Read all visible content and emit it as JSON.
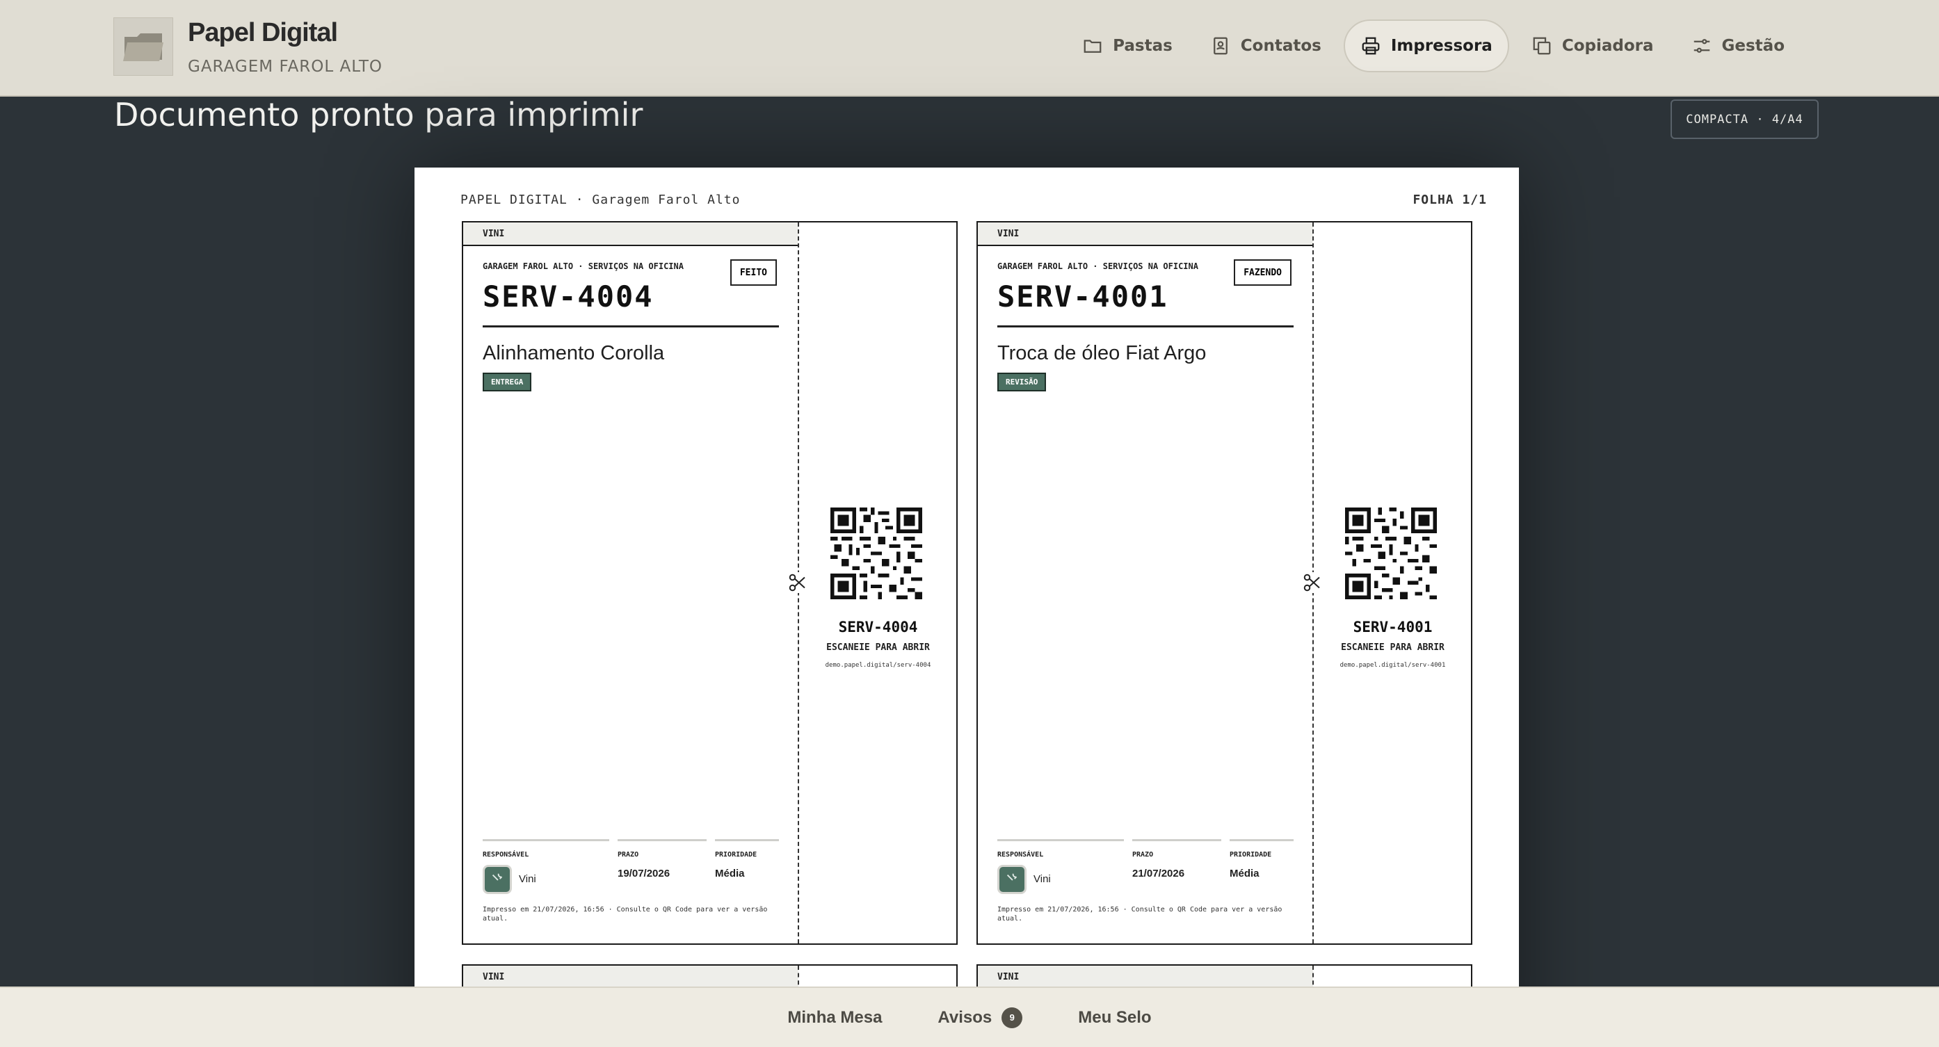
{
  "app": {
    "title": "Papel Digital",
    "subtitle": "GARAGEM FAROL ALTO",
    "logo_icon": "folder-icon"
  },
  "nav": [
    {
      "label": "Pastas",
      "icon": "folder-icon",
      "active": false
    },
    {
      "label": "Contatos",
      "icon": "contact-book-icon",
      "active": false
    },
    {
      "label": "Impressora",
      "icon": "printer-icon",
      "active": true
    },
    {
      "label": "Copiadora",
      "icon": "copy-icon",
      "active": false
    },
    {
      "label": "Gestão",
      "icon": "sliders-icon",
      "active": false
    }
  ],
  "main": {
    "page_title": "Documento pronto para imprimir",
    "mode_badge": "COMPACTA · 4/A4"
  },
  "sheet": {
    "header_left": "PAPEL DIGITAL · Garagem Farol Alto",
    "header_right": "FOLHA 1/1",
    "tickets": [
      {
        "owner_tab": "VINI",
        "company": "GARAGEM FAROL ALTO · SERVIÇOS NA OFICINA",
        "status": "FEITO",
        "code": "SERV-4004",
        "title": "Alinhamento Corolla",
        "tag": "ENTREGA",
        "qr_code": "SERV-4004",
        "qr_hint": "ESCANEIE PARA ABRIR",
        "qr_url": "demo.papel.digital/serv-4004",
        "responsavel_label": "RESPONSÁVEL",
        "responsavel": "Vini",
        "prazo_label": "PRAZO",
        "prazo": "19/07/2026",
        "prioridade_label": "PRIORIDADE",
        "prioridade": "Média",
        "footnote": "Impresso em 21/07/2026, 16:56 · Consulte o QR Code para ver a versão atual."
      },
      {
        "owner_tab": "VINI",
        "company": "GARAGEM FAROL ALTO · SERVIÇOS NA OFICINA",
        "status": "FAZENDO",
        "code": "SERV-4001",
        "title": "Troca de óleo Fiat Argo",
        "tag": "REVISÃO",
        "qr_code": "SERV-4001",
        "qr_hint": "ESCANEIE PARA ABRIR",
        "qr_url": "demo.papel.digital/serv-4001",
        "responsavel_label": "RESPONSÁVEL",
        "responsavel": "Vini",
        "prazo_label": "PRAZO",
        "prazo": "21/07/2026",
        "prioridade_label": "PRIORIDADE",
        "prioridade": "Média",
        "footnote": "Impresso em 21/07/2026, 16:56 · Consulte o QR Code para ver a versão atual."
      }
    ],
    "next_row_tabs": [
      "VINI",
      "VINI"
    ]
  },
  "bottom_bar": {
    "items": [
      {
        "label": "Minha Mesa"
      },
      {
        "label": "Avisos",
        "badge": "9"
      },
      {
        "label": "Meu Selo"
      }
    ]
  },
  "colors": {
    "header_bg": "#e0ddd3",
    "canvas_bg": "#2c3338",
    "tag_green": "#4b7062"
  }
}
